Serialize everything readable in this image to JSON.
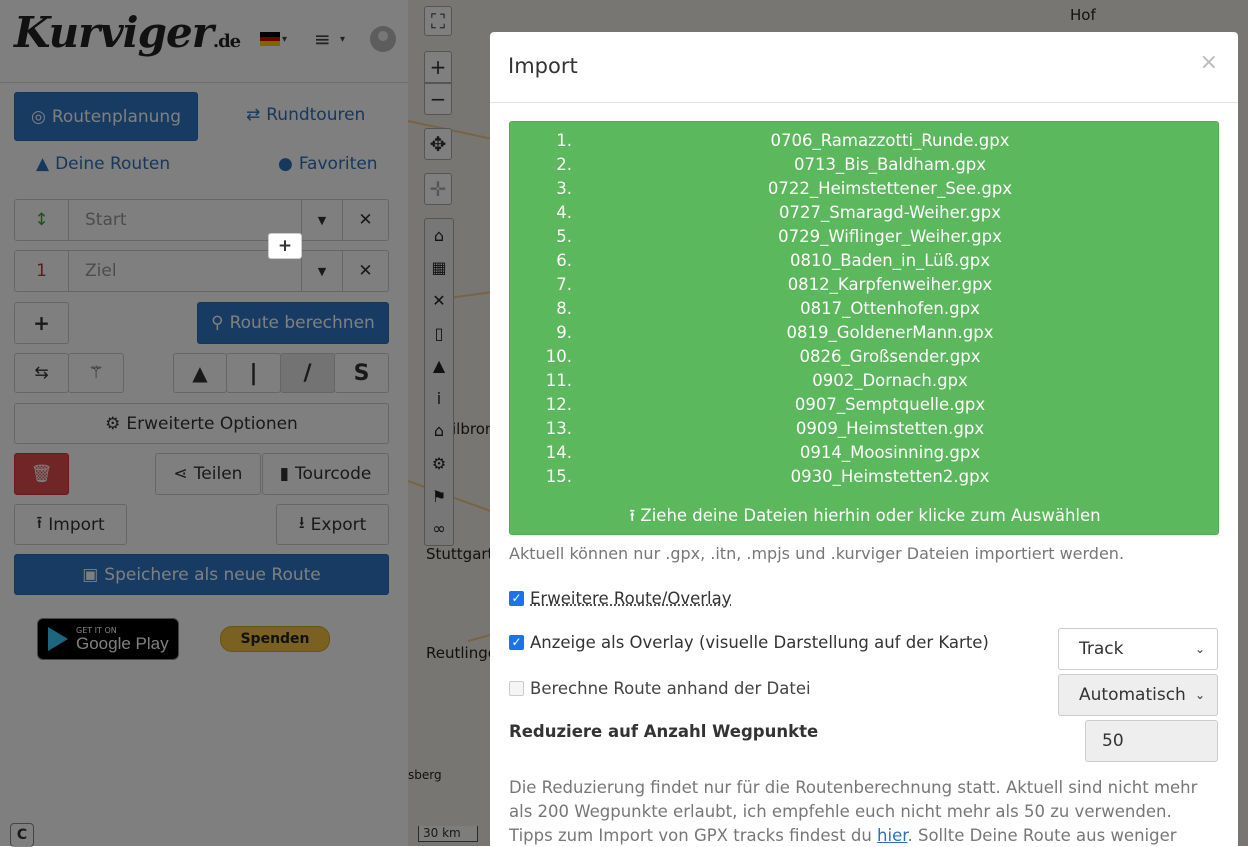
{
  "sidebar": {
    "logo": "Kurviger",
    "logo_suffix": ".de",
    "tabs": {
      "route_planning": "Routenplanung",
      "round_tours": "Rundtouren",
      "your_routes": "Deine Routen",
      "favorites": "Favoriten"
    },
    "start_placeholder": "Start",
    "goal_placeholder": "Ziel",
    "goal_number": "1",
    "calc_route": "Route berechnen",
    "extended_options": "Erweiterte Optionen",
    "share": "Teilen",
    "tourcode": "Tourcode",
    "import": "Import",
    "export": "Export",
    "save_as_new": "Speichere als neue Route",
    "google_small": "GET IT ON",
    "google_big": "Google Play",
    "donate": "Spenden",
    "colors": {
      "primary": "#3077c9",
      "danger": "#e14d4d"
    }
  },
  "map": {
    "labels": {
      "hof": "Hof",
      "heilbronn": "ilbron",
      "stuttgart": "Stuttgart",
      "reutlingen": "Reutlinge",
      "sberg": "sberg"
    },
    "scale": "30 km"
  },
  "modal": {
    "title": "Import",
    "close": "×",
    "files": [
      {
        "n": "1.",
        "name": "0706_Ramazzotti_Runde.gpx"
      },
      {
        "n": "2.",
        "name": "0713_Bis_Baldham.gpx"
      },
      {
        "n": "3.",
        "name": "0722_Heimstettener_See.gpx"
      },
      {
        "n": "4.",
        "name": "0727_Smaragd-Weiher.gpx"
      },
      {
        "n": "5.",
        "name": "0729_Wiflinger_Weiher.gpx"
      },
      {
        "n": "6.",
        "name": "0810_Baden_in_Lüß.gpx"
      },
      {
        "n": "7.",
        "name": "0812_Karpfenweiher.gpx"
      },
      {
        "n": "8.",
        "name": "0817_Ottenhofen.gpx"
      },
      {
        "n": "9.",
        "name": "0819_GoldenerMann.gpx"
      },
      {
        "n": "10.",
        "name": "0826_Großsender.gpx"
      },
      {
        "n": "11.",
        "name": "0902_Dornach.gpx"
      },
      {
        "n": "12.",
        "name": "0907_Semptquelle.gpx"
      },
      {
        "n": "13.",
        "name": "0909_Heimstetten.gpx"
      },
      {
        "n": "14.",
        "name": "0914_Moosinning.gpx"
      },
      {
        "n": "15.",
        "name": "0930_Heimstetten2.gpx"
      }
    ],
    "drop_hint": "Ziehe deine Dateien hierhin oder klicke zum Auswählen",
    "formats_note": "Aktuell können nur .gpx, .itn, .mpjs und .kurviger Dateien importiert werden.",
    "extended_route": "Erweitere Route/Overlay",
    "overlay_label": "Anzeige als Overlay (visuelle Darstellung auf der Karte)",
    "overlay_value": "Track",
    "calc_label": "Berechne Route anhand der Datei",
    "calc_value": "Automatisch",
    "reduce_label": "Reduziere auf Anzahl Wegpunkte",
    "reduce_value": "50",
    "para_before_link": "Die Reduzierung findet nur für die Routenberechnung statt. Aktuell sind nicht mehr als 200 Wegpunkte erlaubt, ich empfehle euch nicht mehr als 50 zu verwenden. Tipps zum Import von GPX tracks findest du ",
    "para_link": "hier",
    "para_after_link": ". Sollte Deine Route aus weniger Punkten als",
    "colors": {
      "dropzone": "#5cb85c"
    }
  }
}
